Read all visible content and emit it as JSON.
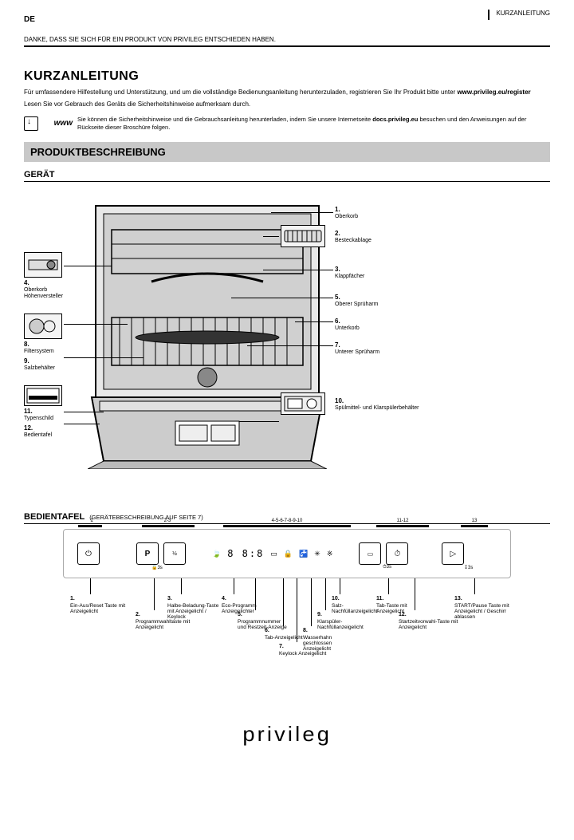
{
  "header": {
    "lang": "DE",
    "doc_type": "KURZANLEITUNG",
    "thanks": "DANKE, DASS SIE SICH FÜR EIN PRODUKT VON PRIVILEG ENTSCHIEDEN HABEN."
  },
  "intro": {
    "line1": "Lesen Sie vor Gebrauch des Geräts die Sicherheitshinweise aufmerksam durch.",
    "line2": "Für umfassendere Hilfestellung und Unterstützung, und um die vollständige Bedienungsanleitung herunterzuladen, registrieren Sie Ihr Produkt bitte unter",
    "url": "www.privileg.eu/register",
    "dl_prefix": "Sie können die Sicherheitshinweise und die Gebrauchsanleitung herunterladen, indem Sie unsere Internetseite",
    "dl_site": "docs.privileg.eu",
    "dl_suffix": "besuchen und den Anweisungen auf der Rückseite dieser Broschüre folgen."
  },
  "section": {
    "title": "PRODUKTBESCHREIBUNG",
    "appliance_title": "GERÄT",
    "panel_title": "BEDIENTAFEL",
    "panel_note": "(GERÄTEBESCHREIBUNG AUF SEITE 7)"
  },
  "callouts": {
    "c1": {
      "n": "1.",
      "t": "Oberkorb"
    },
    "c2": {
      "n": "2.",
      "t": "Besteckablage"
    },
    "c3": {
      "n": "3.",
      "t": "Klappfächer"
    },
    "c4": {
      "n": "4.",
      "t": "Oberkorb Höhenversteller"
    },
    "c5": {
      "n": "5.",
      "t": "Oberer Sprüharm"
    },
    "c6": {
      "n": "6.",
      "t": "Unterkorb"
    },
    "c7": {
      "n": "7.",
      "t": "Unterer Sprüharm"
    },
    "c8": {
      "n": "8.",
      "t": "Filtersystem"
    },
    "c9": {
      "n": "9.",
      "t": "Salzbehälter"
    },
    "c10": {
      "n": "10.",
      "t": "Spülmittel- und Klarspülerbehälter"
    },
    "c11": {
      "n": "11.",
      "t": "Typenschild"
    },
    "c12": {
      "n": "12.",
      "t": "Bedientafel"
    }
  },
  "panel_groups": {
    "g1": "1",
    "g2": "2-3",
    "g3": "4-5-6-7-8-9-10",
    "g4": "11-12",
    "g5": "13"
  },
  "panel": {
    "p1": {
      "n": "1.",
      "t": "Ein-Aus/Reset Taste mit Anzeigelicht"
    },
    "p2": {
      "n": "2.",
      "t": "Programmwahltaste mit Anzeigelicht"
    },
    "p3": {
      "n": "3.",
      "t": "Halbe-Beladung-Taste mit Anzeigelicht / Keylock"
    },
    "p4": {
      "n": "4.",
      "t": "Eco-Programm Anzeigelichter"
    },
    "p5": {
      "n": "5.",
      "t": "Programmnummer und Restzeit-Anzeige"
    },
    "p6": {
      "n": "6.",
      "t": "Tab-Anzeigelicht"
    },
    "p7": {
      "n": "7.",
      "t": "Keylock Anzeigelicht"
    },
    "p8": {
      "n": "8.",
      "t": "Wasserhahn geschlossen Anzeigelicht"
    },
    "p9": {
      "n": "9.",
      "t": "Klarspüler-Nachfüllanzeigelicht"
    },
    "p10": {
      "n": "10.",
      "t": "Salz-Nachfüllanzeigelicht"
    },
    "p11": {
      "n": "11.",
      "t": "Tab-Taste mit Anzeigelicht"
    },
    "p12": {
      "n": "12.",
      "t": "Startzeitvorwahl-Taste mit Anzeigelicht"
    },
    "p13": {
      "n": "13.",
      "t": "START/Pause Taste mit Anzeigelicht / Geschirr ablassen"
    }
  },
  "brand": "privileg"
}
